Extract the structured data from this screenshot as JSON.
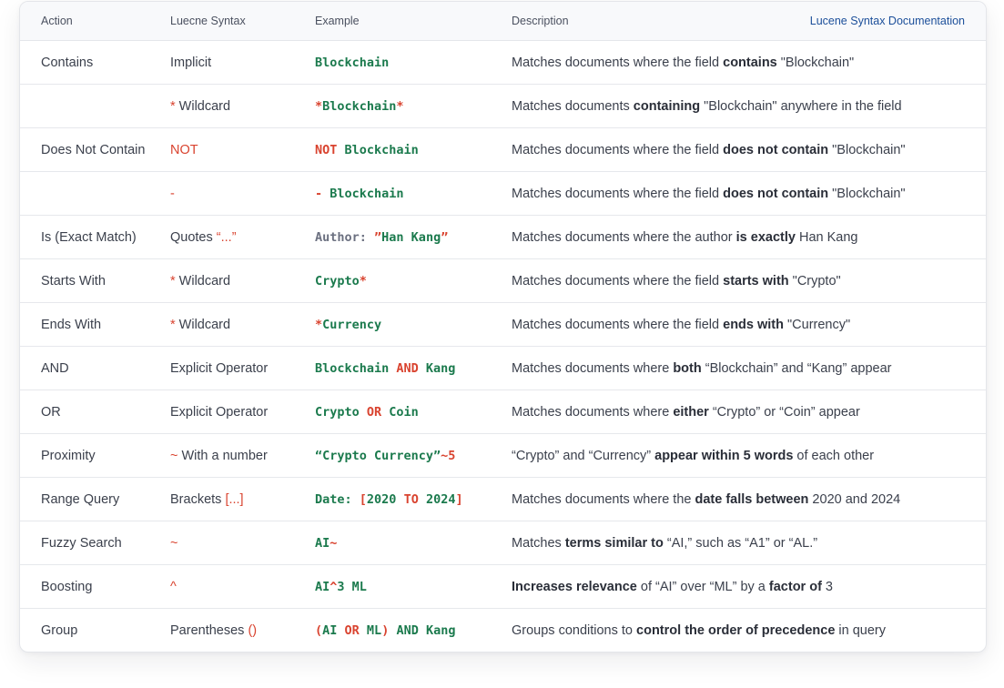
{
  "header": {
    "action": "Action",
    "syntax": "Luecne Syntax",
    "example": "Example",
    "description": "Description",
    "doc_link": "Lucene Syntax Documentation"
  },
  "colors": {
    "green": "#1b7a4d",
    "red": "#d9432f",
    "link": "#1c4f9a"
  },
  "rows": [
    {
      "action": "Contains",
      "syntax": [
        {
          "t": "Implicit",
          "c": "n"
        }
      ],
      "example": [
        {
          "t": "Blockchain",
          "c": "g"
        }
      ],
      "desc": [
        {
          "t": "Matches documents where the field "
        },
        {
          "t": "contains",
          "b": true
        },
        {
          "t": " \"Blockchain\""
        }
      ]
    },
    {
      "action": "",
      "syntax": [
        {
          "t": "* ",
          "c": "r"
        },
        {
          "t": "Wildcard",
          "c": "n"
        }
      ],
      "example": [
        {
          "t": "*",
          "c": "r"
        },
        {
          "t": "Blockchain",
          "c": "g"
        },
        {
          "t": "*",
          "c": "r"
        }
      ],
      "desc": [
        {
          "t": "Matches documents "
        },
        {
          "t": "containing",
          "b": true
        },
        {
          "t": " \"Blockchain\" anywhere in the field"
        }
      ]
    },
    {
      "action": "Does Not Contain",
      "syntax": [
        {
          "t": "NOT",
          "c": "r"
        }
      ],
      "example": [
        {
          "t": "NOT ",
          "c": "r"
        },
        {
          "t": "Blockchain",
          "c": "g"
        }
      ],
      "desc": [
        {
          "t": "Matches documents where the field "
        },
        {
          "t": "does not contain",
          "b": true
        },
        {
          "t": " \"Blockchain\""
        }
      ]
    },
    {
      "action": "",
      "syntax": [
        {
          "t": "-",
          "c": "r"
        }
      ],
      "example": [
        {
          "t": "- ",
          "c": "r"
        },
        {
          "t": "Blockchain",
          "c": "g"
        }
      ],
      "desc": [
        {
          "t": "Matches documents where the field "
        },
        {
          "t": "does not contain",
          "b": true
        },
        {
          "t": " \"Blockchain\""
        }
      ]
    },
    {
      "action": "Is (Exact Match)",
      "syntax": [
        {
          "t": "Quotes ",
          "c": "n"
        },
        {
          "t": "“...”",
          "c": "r"
        }
      ],
      "example": [
        {
          "t": "Author: ",
          "c": "gr"
        },
        {
          "t": "”",
          "c": "r"
        },
        {
          "t": "Han Kang",
          "c": "g"
        },
        {
          "t": "”",
          "c": "r"
        }
      ],
      "desc": [
        {
          "t": "Matches documents where the author "
        },
        {
          "t": "is exactly",
          "b": true
        },
        {
          "t": " Han Kang"
        }
      ]
    },
    {
      "action": "Starts With",
      "syntax": [
        {
          "t": "* ",
          "c": "r"
        },
        {
          "t": "Wildcard",
          "c": "n"
        }
      ],
      "example": [
        {
          "t": "Crypto",
          "c": "g"
        },
        {
          "t": "*",
          "c": "r"
        }
      ],
      "desc": [
        {
          "t": "Matches documents where the field "
        },
        {
          "t": "starts with",
          "b": true
        },
        {
          "t": " \"Crypto\""
        }
      ]
    },
    {
      "action": "Ends With",
      "syntax": [
        {
          "t": "* ",
          "c": "r"
        },
        {
          "t": "Wildcard",
          "c": "n"
        }
      ],
      "example": [
        {
          "t": "*",
          "c": "r"
        },
        {
          "t": "Currency",
          "c": "g"
        }
      ],
      "desc": [
        {
          "t": "Matches documents where the field "
        },
        {
          "t": "ends with",
          "b": true
        },
        {
          "t": " \"Currency\""
        }
      ]
    },
    {
      "action": "AND",
      "syntax": [
        {
          "t": "Explicit Operator",
          "c": "n"
        }
      ],
      "example": [
        {
          "t": "Blockchain ",
          "c": "g"
        },
        {
          "t": "AND",
          "c": "r"
        },
        {
          "t": " Kang",
          "c": "g"
        }
      ],
      "desc": [
        {
          "t": "Matches documents where "
        },
        {
          "t": "both",
          "b": true
        },
        {
          "t": " “Blockchain” and “Kang” appear"
        }
      ]
    },
    {
      "action": "OR",
      "syntax": [
        {
          "t": "Explicit Operator",
          "c": "n"
        }
      ],
      "example": [
        {
          "t": "Crypto ",
          "c": "g"
        },
        {
          "t": "OR",
          "c": "r"
        },
        {
          "t": " Coin",
          "c": "g"
        }
      ],
      "desc": [
        {
          "t": "Matches documents where "
        },
        {
          "t": "either",
          "b": true
        },
        {
          "t": " “Crypto” or “Coin” appear"
        }
      ]
    },
    {
      "action": "Proximity",
      "syntax": [
        {
          "t": "~ ",
          "c": "r"
        },
        {
          "t": "With a number",
          "c": "n"
        }
      ],
      "example": [
        {
          "t": "“Crypto Currency”",
          "c": "g"
        },
        {
          "t": "~5",
          "c": "r"
        }
      ],
      "desc": [
        {
          "t": "“Crypto” and “Currency” "
        },
        {
          "t": "appear within 5 words",
          "b": true
        },
        {
          "t": " of each other"
        }
      ]
    },
    {
      "action": "Range Query",
      "syntax": [
        {
          "t": "Brackets ",
          "c": "n"
        },
        {
          "t": "[...]",
          "c": "r"
        }
      ],
      "example": [
        {
          "t": "Date: ",
          "c": "g"
        },
        {
          "t": "[",
          "c": "r"
        },
        {
          "t": "2020 ",
          "c": "g"
        },
        {
          "t": "TO",
          "c": "r"
        },
        {
          "t": " 2024",
          "c": "g"
        },
        {
          "t": "]",
          "c": "r"
        }
      ],
      "desc": [
        {
          "t": "Matches documents where the "
        },
        {
          "t": "date falls between",
          "b": true
        },
        {
          "t": " 2020 and 2024"
        }
      ]
    },
    {
      "action": "Fuzzy Search",
      "syntax": [
        {
          "t": "~",
          "c": "r"
        }
      ],
      "example": [
        {
          "t": "AI",
          "c": "g"
        },
        {
          "t": "~",
          "c": "r"
        }
      ],
      "desc": [
        {
          "t": "Matches "
        },
        {
          "t": "terms similar to",
          "b": true
        },
        {
          "t": " “AI,” such as “A1” or “AL.”"
        }
      ]
    },
    {
      "action": "Boosting",
      "syntax": [
        {
          "t": "^",
          "c": "r"
        }
      ],
      "example": [
        {
          "t": "AI",
          "c": "g"
        },
        {
          "t": "^",
          "c": "r"
        },
        {
          "t": "3 ML",
          "c": "g"
        }
      ],
      "desc": [
        {
          "t": "Increases relevance",
          "b": true
        },
        {
          "t": " of “AI” over “ML” by a "
        },
        {
          "t": "factor of",
          "b": true
        },
        {
          "t": " 3"
        }
      ]
    },
    {
      "action": "Group",
      "syntax": [
        {
          "t": "Parentheses ",
          "c": "n"
        },
        {
          "t": "()",
          "c": "r"
        }
      ],
      "example": [
        {
          "t": "(",
          "c": "r"
        },
        {
          "t": "AI ",
          "c": "g"
        },
        {
          "t": "OR",
          "c": "r"
        },
        {
          "t": " ML",
          "c": "g"
        },
        {
          "t": ")",
          "c": "r"
        },
        {
          "t": " AND Kang",
          "c": "g"
        }
      ],
      "desc": [
        {
          "t": "Groups conditions to "
        },
        {
          "t": "control the order of precedence",
          "b": true
        },
        {
          "t": " in query"
        }
      ]
    }
  ]
}
